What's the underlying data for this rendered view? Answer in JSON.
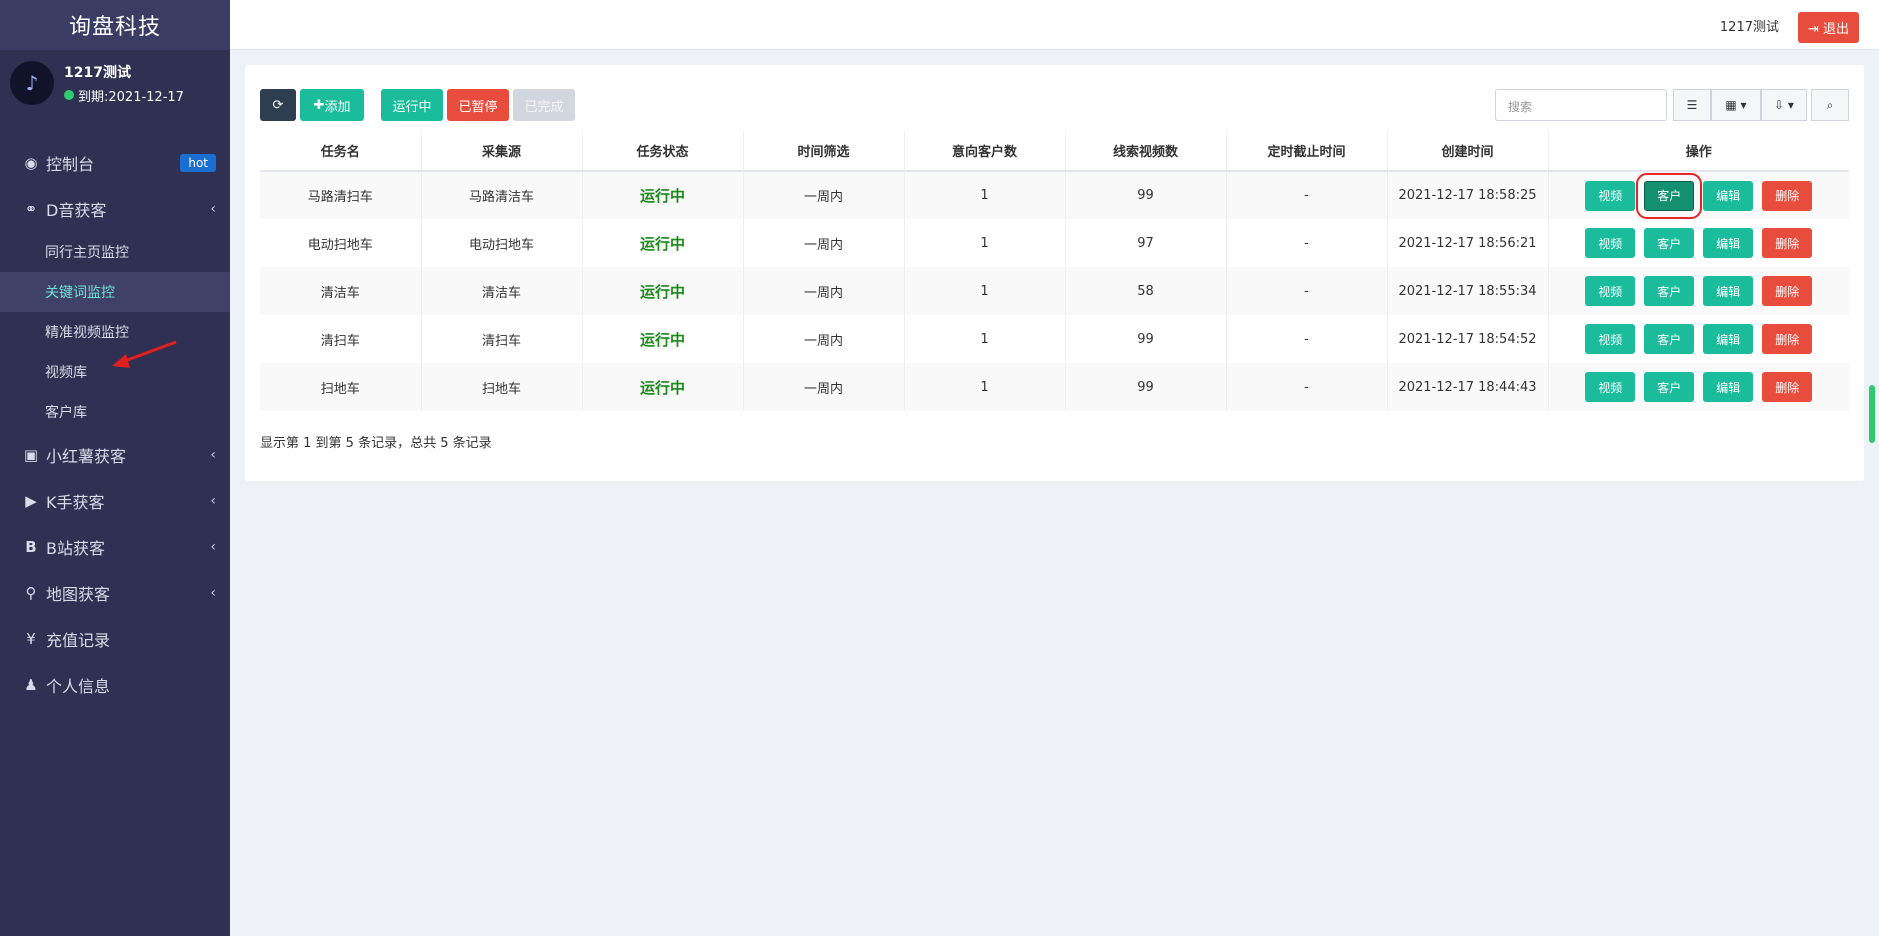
{
  "brand": "询盘科技",
  "user": {
    "name": "1217测试",
    "expire": "到期:2021-12-17"
  },
  "menu": {
    "dashboard": "控制台",
    "hot": "hot",
    "douyin": "D音获客",
    "subs": [
      "同行主页监控",
      "关键词监控",
      "精准视频监控",
      "视频库",
      "客户库"
    ],
    "xiaohongshu": "小红薯获客",
    "kuaishou": "K手获客",
    "bilibili": "B站获客",
    "map": "地图获客",
    "recharge": "充值记录",
    "profile": "个人信息"
  },
  "top": {
    "username": "1217测试",
    "logout": "退出"
  },
  "toolbar": {
    "add": "添加",
    "running": "运行中",
    "paused": "已暂停",
    "done": "已完成",
    "search_placeholder": "搜索"
  },
  "table": {
    "headers": [
      "任务名",
      "采集源",
      "任务状态",
      "时间筛选",
      "意向客户数",
      "线索视频数",
      "定时截止时间",
      "创建时间",
      "操作"
    ],
    "rows": [
      [
        "马路清扫车",
        "马路清洁车",
        "运行中",
        "一周内",
        "1",
        "99",
        "-",
        "2021-12-17 18:58:25"
      ],
      [
        "电动扫地车",
        "电动扫地车",
        "运行中",
        "一周内",
        "1",
        "97",
        "-",
        "2021-12-17 18:56:21"
      ],
      [
        "清洁车",
        "清洁车",
        "运行中",
        "一周内",
        "1",
        "58",
        "-",
        "2021-12-17 18:55:34"
      ],
      [
        "清扫车",
        "清扫车",
        "运行中",
        "一周内",
        "1",
        "99",
        "-",
        "2021-12-17 18:54:52"
      ],
      [
        "扫地车",
        "扫地车",
        "运行中",
        "一周内",
        "1",
        "99",
        "-",
        "2021-12-17 18:44:43"
      ]
    ],
    "ops": [
      "视频",
      "客户",
      "编辑",
      "删除"
    ]
  },
  "summary": "显示第 1 到第 5 条记录，总共 5 条记录"
}
